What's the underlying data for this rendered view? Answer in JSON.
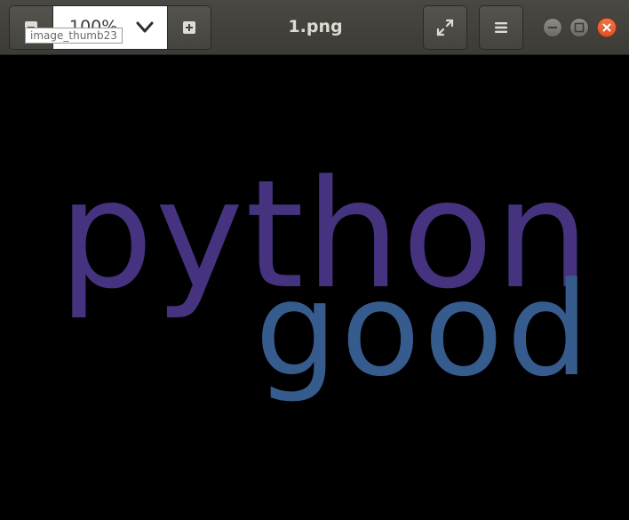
{
  "window": {
    "title": "1.png"
  },
  "toolbar": {
    "zoom_level": "100%",
    "tooltip": "image_thumb23"
  },
  "icons": {
    "zoom_out": "zoom-out-icon",
    "zoom_in": "zoom-in-icon",
    "zoom_dropdown": "chevron-down-icon",
    "fullscreen": "fullscreen-icon",
    "menu": "hamburger-menu-icon",
    "minimize": "minimize-icon",
    "maximize": "maximize-icon",
    "close": "close-icon"
  },
  "image": {
    "background": "#000000",
    "words": [
      {
        "text": "python",
        "color": "#46337f"
      },
      {
        "text": "good",
        "color": "#365c8d"
      }
    ]
  },
  "colors": {
    "headerbar": "#3c3b37",
    "close_button": "#e95420"
  }
}
